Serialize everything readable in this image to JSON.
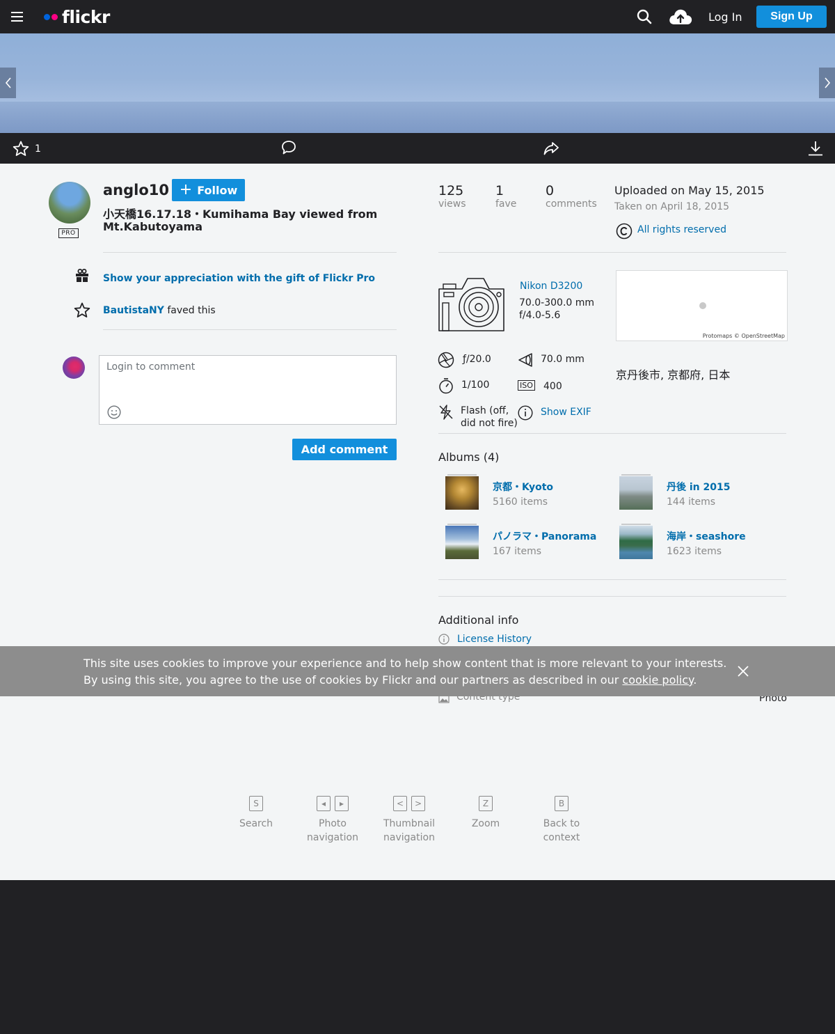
{
  "nav": {
    "logo": "flickr",
    "login": "Log In",
    "signup": "Sign Up"
  },
  "actions": {
    "fave_count": "1"
  },
  "owner": {
    "name": "anglo10",
    "pro": "PRO",
    "follow": "Follow"
  },
  "photo": {
    "title": "小天橋16.17.18・Kumihama Bay viewed from Mt.Kabutoyama"
  },
  "appreciation": {
    "gift": "Show your appreciation with the gift of Flickr Pro",
    "faved_by": "BautistaNY",
    "faved_suffix": " faved this"
  },
  "comment": {
    "placeholder": "Login to comment",
    "button": "Add comment"
  },
  "stats": [
    {
      "num": "125",
      "label": "views"
    },
    {
      "num": "1",
      "label": "fave"
    },
    {
      "num": "0",
      "label": "comments"
    }
  ],
  "dates": {
    "uploaded": "Uploaded on May 15, 2015",
    "taken": "Taken on April 18, 2015"
  },
  "license": "All rights reserved",
  "camera": {
    "name": "Nikon D3200",
    "lens": "70.0-300.0 mm",
    "aperture_range": "f/4.0-5.6"
  },
  "map": {
    "attribution": "Protomaps © OpenStreetMap",
    "location": "京丹後市, 京都府, 日本"
  },
  "exif": {
    "aperture": "ƒ/20.0",
    "focal": "70.0 mm",
    "shutter": "1/100",
    "iso_badge": "ISO",
    "iso": "400",
    "flash_line1": "Flash (off,",
    "flash_line2": "did not fire)",
    "show_exif": "Show EXIF"
  },
  "albums": {
    "title": "Albums (4)",
    "items": [
      {
        "name": "京都・Kyoto",
        "count": "5160 items"
      },
      {
        "name": "丹後 in 2015",
        "count": "144 items"
      },
      {
        "name": "パノラマ・Panorama",
        "count": "167 items"
      },
      {
        "name": "海岸・seashore",
        "count": "1623 items"
      }
    ]
  },
  "additional": {
    "title": "Additional info",
    "license_history": "License History",
    "content_type_label": "Content type",
    "content_type_value": "Photo"
  },
  "cookie": {
    "text": "This site uses cookies to improve your experience and to help show content that is more relevant to your interests. By using this site, you agree to the use of cookies by Flickr and our partners as described in our ",
    "link": "cookie policy",
    "end": "."
  },
  "shortcuts": [
    {
      "keys": [
        "S"
      ],
      "line1": "Search",
      "line2": ""
    },
    {
      "keys": [
        "◂",
        "▸"
      ],
      "line1": "Photo",
      "line2": "navigation"
    },
    {
      "keys": [
        "<",
        ">"
      ],
      "line1": "Thumbnail",
      "line2": "navigation"
    },
    {
      "keys": [
        "Z"
      ],
      "line1": "Zoom",
      "line2": ""
    },
    {
      "keys": [
        "B"
      ],
      "line1": "Back to",
      "line2": "context"
    }
  ],
  "colors": {
    "brand_blue": "#0063dc",
    "brand_pink": "#ff0084",
    "button": "#128fdc",
    "link": "#006dac"
  }
}
